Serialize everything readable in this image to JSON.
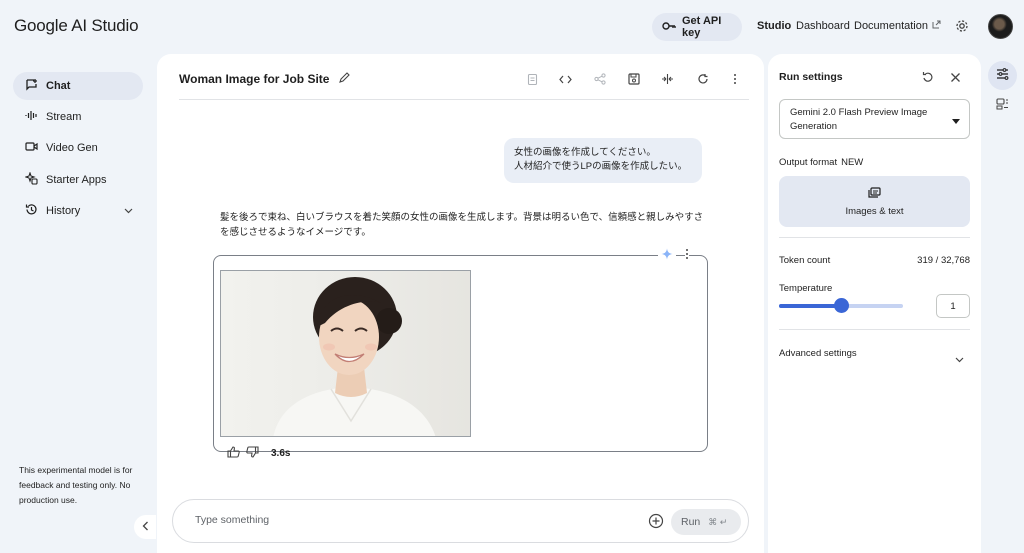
{
  "header": {
    "logo": "Google AI Studio",
    "api_key_label": "Get API key",
    "nav": {
      "studio": "Studio",
      "dashboard": "Dashboard",
      "documentation": "Documentation"
    }
  },
  "sidebar": {
    "items": [
      {
        "label": "Chat",
        "icon": "chat-icon",
        "active": true
      },
      {
        "label": "Stream",
        "icon": "waveform-icon"
      },
      {
        "label": "Video Gen",
        "icon": "video-icon"
      },
      {
        "label": "Starter Apps",
        "icon": "sparkle-apps-icon"
      },
      {
        "label": "History",
        "icon": "history-icon"
      }
    ],
    "disclaimer": "This experimental model is for feedback and testing only. No production use."
  },
  "chat": {
    "title": "Woman Image for Job Site",
    "user_message_line1": "女性の画像を作成してください。",
    "user_message_line2": "人材紹介で使うLPの画像を作成したい。",
    "model_message": "髪を後ろで束ね、白いブラウスを着た笑顔の女性の画像を生成します。背景は明るい色で、信頼感と親しみやすさを感じさせるようなイメージです。",
    "response_time": "3.6s",
    "prompt_placeholder": "Type something",
    "run_label": "Run",
    "run_shortcut": "⌘ ↵"
  },
  "run_settings": {
    "title": "Run settings",
    "model": "Gemini 2.0 Flash Preview Image Generation",
    "output_format_label": "Output format",
    "output_format_badge": "NEW",
    "output_format_value": "Images & text",
    "token_count_label": "Token count",
    "token_count_value": "319 / 32,768",
    "temperature_label": "Temperature",
    "temperature_value": "1",
    "temperature_fraction": 0.5,
    "advanced_label": "Advanced settings"
  },
  "colors": {
    "accent": "#3a66d6",
    "surface": "#ffffff",
    "background": "#f0f4f9"
  }
}
